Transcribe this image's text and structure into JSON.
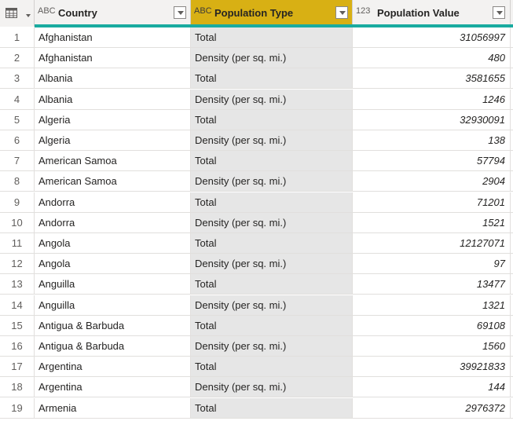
{
  "columns": [
    {
      "type_icon": "ABC",
      "label": "Country"
    },
    {
      "type_icon": "ABC",
      "label": "Population Type"
    },
    {
      "type_icon": "123",
      "label": "Population Value"
    }
  ],
  "rows": [
    {
      "index": "1",
      "country": "Afghanistan",
      "ptype": "Total",
      "pvalue": "31056997"
    },
    {
      "index": "2",
      "country": "Afghanistan",
      "ptype": "Density (per sq. mi.)",
      "pvalue": "480"
    },
    {
      "index": "3",
      "country": "Albania",
      "ptype": "Total",
      "pvalue": "3581655"
    },
    {
      "index": "4",
      "country": "Albania",
      "ptype": "Density (per sq. mi.)",
      "pvalue": "1246"
    },
    {
      "index": "5",
      "country": "Algeria",
      "ptype": "Total",
      "pvalue": "32930091"
    },
    {
      "index": "6",
      "country": "Algeria",
      "ptype": "Density (per sq. mi.)",
      "pvalue": "138"
    },
    {
      "index": "7",
      "country": "American Samoa",
      "ptype": "Total",
      "pvalue": "57794"
    },
    {
      "index": "8",
      "country": "American Samoa",
      "ptype": "Density (per sq. mi.)",
      "pvalue": "2904"
    },
    {
      "index": "9",
      "country": "Andorra",
      "ptype": "Total",
      "pvalue": "71201"
    },
    {
      "index": "10",
      "country": "Andorra",
      "ptype": "Density (per sq. mi.)",
      "pvalue": "1521"
    },
    {
      "index": "11",
      "country": "Angola",
      "ptype": "Total",
      "pvalue": "12127071"
    },
    {
      "index": "12",
      "country": "Angola",
      "ptype": "Density (per sq. mi.)",
      "pvalue": "97"
    },
    {
      "index": "13",
      "country": "Anguilla",
      "ptype": "Total",
      "pvalue": "13477"
    },
    {
      "index": "14",
      "country": "Anguilla",
      "ptype": "Density (per sq. mi.)",
      "pvalue": "1321"
    },
    {
      "index": "15",
      "country": "Antigua & Barbuda",
      "ptype": "Total",
      "pvalue": "69108"
    },
    {
      "index": "16",
      "country": "Antigua & Barbuda",
      "ptype": "Density (per sq. mi.)",
      "pvalue": "1560"
    },
    {
      "index": "17",
      "country": "Argentina",
      "ptype": "Total",
      "pvalue": "39921833"
    },
    {
      "index": "18",
      "country": "Argentina",
      "ptype": "Density (per sq. mi.)",
      "pvalue": "144"
    },
    {
      "index": "19",
      "country": "Armenia",
      "ptype": "Total",
      "pvalue": "2976372"
    }
  ],
  "colors": {
    "selected_header": "#d8b014",
    "selected_column": "#e6e6e6",
    "quality_bar": "#1aaba0"
  }
}
